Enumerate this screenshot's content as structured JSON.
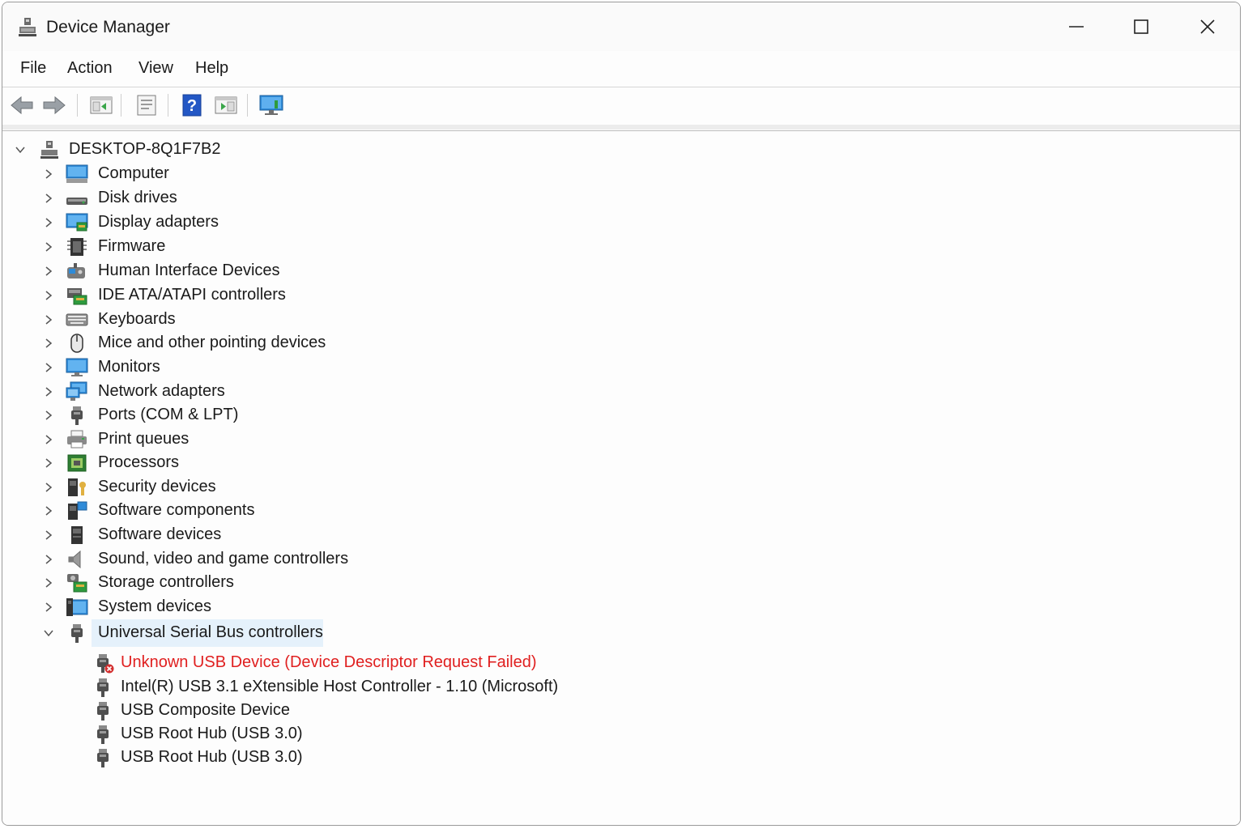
{
  "window": {
    "title": "Device Manager",
    "controls": {
      "minimize": "minimize-icon",
      "maximize": "maximize-icon",
      "close": "close-icon"
    }
  },
  "menu": [
    "File",
    "Action",
    "View",
    "Help"
  ],
  "toolbar": [
    "back-arrow-icon",
    "forward-arrow-icon",
    "show-hide-console-tree-icon",
    "properties-icon",
    "help-icon",
    "action-pane-icon",
    "scan-hardware-icon"
  ],
  "tree": {
    "root": "DESKTOP-8Q1F7B2",
    "categories": [
      "Computer",
      "Disk drives",
      "Display adapters",
      "Firmware",
      "Human Interface Devices",
      "IDE ATA/ATAPI controllers",
      "Keyboards",
      "Mice and other pointing devices",
      "Monitors",
      "Network adapters",
      "Ports (COM & LPT)",
      "Print queues",
      "Processors",
      "Security devices",
      "Software components",
      "Software devices",
      "Sound, video and game controllers",
      "Storage controllers",
      "System devices",
      "Universal Serial Bus controllers"
    ],
    "usb_children": [
      "Unknown USB Device (Device Descriptor Request Failed)",
      "Intel(R) USB 3.1 eXtensible Host Controller - 1.10 (Microsoft)",
      "USB Composite Device",
      "USB Root Hub (USB 3.0)",
      "USB Root Hub (USB 3.0)"
    ]
  },
  "colors": {
    "error_text": "#e02020",
    "selection": "#e5f1fb",
    "accent": "#2f8bd8"
  }
}
